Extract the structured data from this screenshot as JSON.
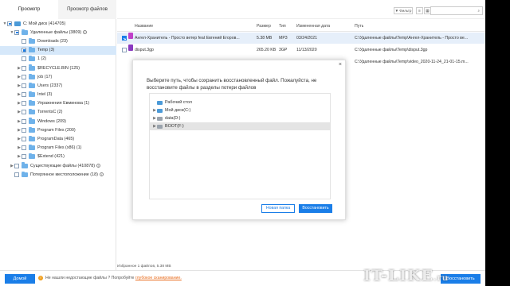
{
  "left_tabs": [
    "Просмотр",
    "Просмотр файлов"
  ],
  "tree": [
    {
      "label": "C: Мой диск (414705)",
      "level": 0,
      "arrow": "▼",
      "check": "part",
      "icon": "drive",
      "info": false,
      "selected": false
    },
    {
      "label": "Удаленные файлы (3809)",
      "level": 1,
      "arrow": "▼",
      "check": "part",
      "icon": "folder",
      "info": true,
      "selected": false
    },
    {
      "label": "Downloads (23)",
      "level": 2,
      "arrow": "",
      "check": "",
      "icon": "folder",
      "info": false,
      "selected": false
    },
    {
      "label": "Temp (3)",
      "level": 2,
      "arrow": "",
      "check": "part",
      "icon": "folder",
      "info": false,
      "selected": true
    },
    {
      "label": "1 (2)",
      "level": 2,
      "arrow": "",
      "check": "",
      "icon": "folder",
      "info": false,
      "selected": false
    },
    {
      "label": "$RECYCLE.BIN (125)",
      "level": 2,
      "arrow": "▶",
      "check": "",
      "icon": "folder",
      "info": false,
      "selected": false
    },
    {
      "label": "job (17)",
      "level": 2,
      "arrow": "▶",
      "check": "",
      "icon": "folder",
      "info": false,
      "selected": false
    },
    {
      "label": "Users (2337)",
      "level": 2,
      "arrow": "▶",
      "check": "",
      "icon": "folder",
      "info": false,
      "selected": false
    },
    {
      "label": "Intel (3)",
      "level": 2,
      "arrow": "▶",
      "check": "",
      "icon": "folder",
      "info": false,
      "selected": false
    },
    {
      "label": "Упражнения Евминова (1)",
      "level": 2,
      "arrow": "▶",
      "check": "",
      "icon": "folder",
      "info": false,
      "selected": false
    },
    {
      "label": "TorrentsC (2)",
      "level": 2,
      "arrow": "▶",
      "check": "",
      "icon": "folder",
      "info": false,
      "selected": false
    },
    {
      "label": "Windows (209)",
      "level": 2,
      "arrow": "▶",
      "check": "",
      "icon": "folder",
      "info": false,
      "selected": false
    },
    {
      "label": "Program Files (200)",
      "level": 2,
      "arrow": "▶",
      "check": "",
      "icon": "folder",
      "info": false,
      "selected": false
    },
    {
      "label": "ProgramData (465)",
      "level": 2,
      "arrow": "▶",
      "check": "",
      "icon": "folder",
      "info": false,
      "selected": false
    },
    {
      "label": "Program Files (x86) (1)",
      "level": 2,
      "arrow": "▶",
      "check": "",
      "icon": "folder",
      "info": false,
      "selected": false
    },
    {
      "label": "$Extend (421)",
      "level": 2,
      "arrow": "▶",
      "check": "",
      "icon": "folder",
      "info": false,
      "selected": false
    },
    {
      "label": "Существующие файлы (410878)",
      "level": 1,
      "arrow": "▶",
      "check": "",
      "icon": "folder",
      "info": true,
      "selected": false
    },
    {
      "label": "Потерянное местоположение (18)",
      "level": 1,
      "arrow": "",
      "check": "",
      "icon": "folder",
      "info": true,
      "selected": false
    }
  ],
  "toolbar": {
    "filter_label": "▼ Фильтр",
    "list_icon": "list-view-icon",
    "grid_icon": "grid-view-icon",
    "search_icon": "search-icon"
  },
  "columns": [
    "Название",
    "Размер",
    "Тип",
    "Измененная дата",
    "Путь"
  ],
  "files": [
    {
      "name": "Ангел-Хранитель - Просто ветер feat Евгений Егоров...",
      "size": "5.38 MB",
      "type": "MP3",
      "date": "03/24/2021",
      "path": "C:\\Удаленные файлы\\Temp\\Ангел-Хранитель - Просто ве...",
      "checked": true,
      "icon_color": "#c040c8",
      "selected": true
    },
    {
      "name": "disput.3gp",
      "size": "265.20 KB",
      "type": "3GP",
      "date": "11/13/2020",
      "path": "C:\\Удаленные файлы\\Temp\\disput.3gp",
      "checked": false,
      "icon_color": "#8a3ac0",
      "selected": false
    },
    {
      "name": "",
      "size": "",
      "type": "",
      "date": "",
      "path": "C:\\Удаленные файлы\\Temp\\video_2020-11-24_21-01-15.m...",
      "checked": false,
      "icon_color": "",
      "selected": false
    }
  ],
  "dialog": {
    "close": "×",
    "message": "Выберите путь, чтобы сохранить восстановленный файл. Пожалуйста, не восстановите файлы в разделы потери файлов",
    "nodes": [
      {
        "label": "Рабочий стол",
        "arrow": "",
        "icon_color": "#4b9ad8",
        "selected": false
      },
      {
        "label": "Мой диск(C:)",
        "arrow": "▶",
        "icon_color": "#4b9ad8",
        "selected": false
      },
      {
        "label": "data(D:)",
        "arrow": "▶",
        "icon_color": "#9aa3ad",
        "selected": false
      },
      {
        "label": "BOOT(F:)",
        "arrow": "▶",
        "icon_color": "#9aa3ad",
        "selected": true
      }
    ],
    "btn_new_folder": "Новая папка",
    "btn_restore": "Восстановить"
  },
  "status_line": "Избранное 1 файлов, 5.38 MB",
  "bottom": {
    "home_button": "Домой",
    "message": "Не нашли недостающие файлы ? Попробуйте",
    "deep_scan_link": "глубокое сканирование.",
    "recover_button": "Восстановить"
  },
  "watermark": {
    "main": "IT-LIKE",
    "suffix": ".ru"
  },
  "colors": {
    "accent": "#1a7ee8",
    "link": "#e86a1a",
    "selection": "#d6e8fa"
  }
}
